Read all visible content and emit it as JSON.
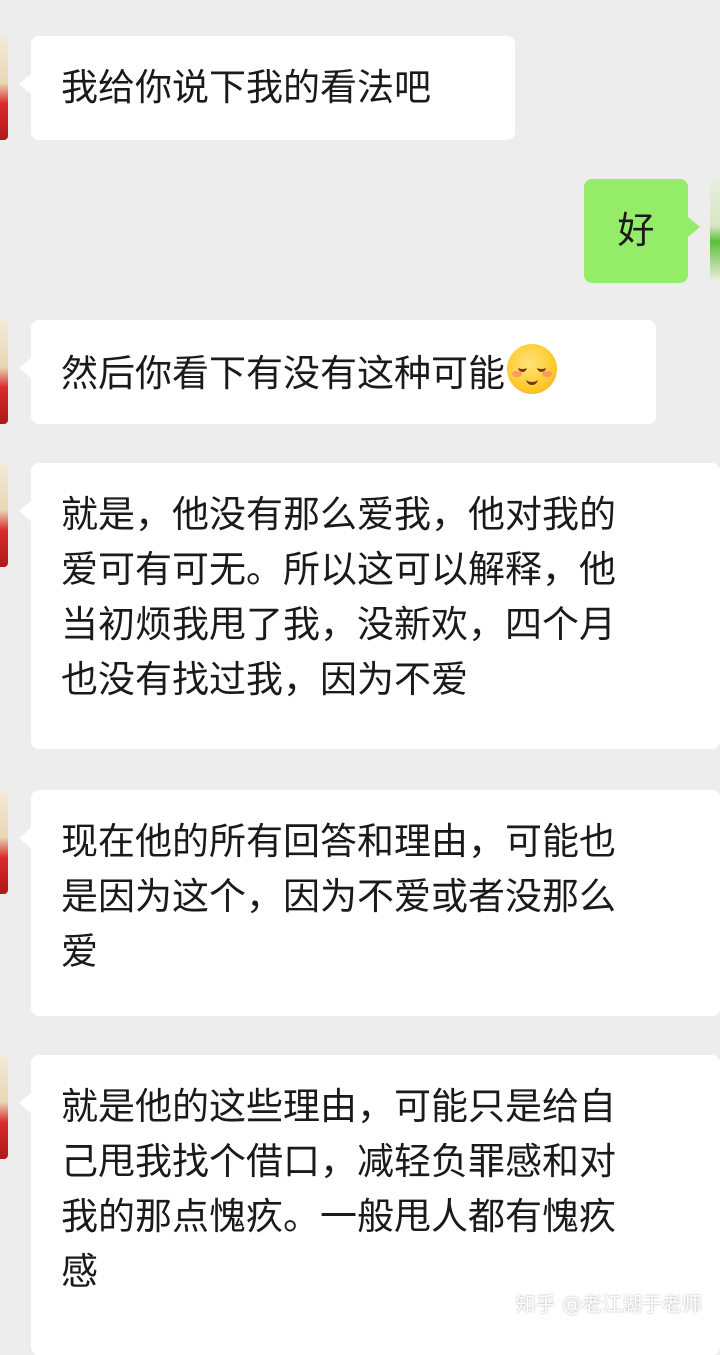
{
  "messages": [
    {
      "side": "left",
      "lines": [
        "我给你说下我的看法吧"
      ]
    },
    {
      "side": "right",
      "lines": [
        "好"
      ]
    },
    {
      "side": "left",
      "lines": [
        "然后你看下有没有这种可能"
      ],
      "emoji": "smiling-face-with-blush-emoji"
    },
    {
      "side": "left",
      "lines": [
        "就是，他没有那么爱我，他对我的",
        "爱可有可无。所以这可以解释，他",
        "当初烦我甩了我，没新欢，四个月",
        "也没有找过我，因为不爱"
      ]
    },
    {
      "side": "left",
      "lines": [
        "现在他的所有回答和理由，可能也",
        "是因为这个，因为不爱或者没那么",
        "爱"
      ]
    },
    {
      "side": "left",
      "lines": [
        "就是他的这些理由，可能只是给自",
        "己甩我找个借口，减轻负罪感和对",
        "我的那点愧疚。一般甩人都有愧疚",
        "感"
      ]
    }
  ],
  "watermark": "知乎 @老江湖于老师",
  "colors": {
    "background": "#ededed",
    "left_bubble": "#ffffff",
    "right_bubble": "#95ec69",
    "text": "#1a1a1a"
  }
}
